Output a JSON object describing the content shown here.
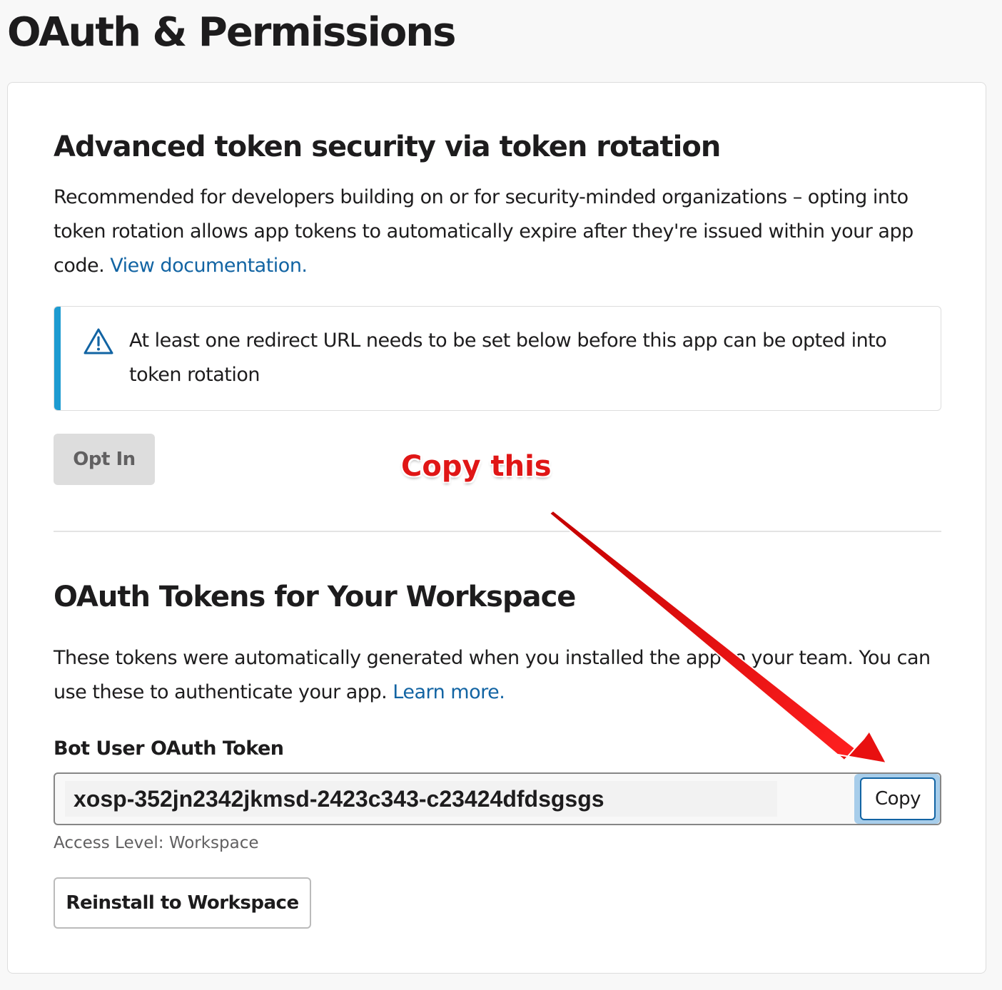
{
  "page": {
    "title": "OAuth & Permissions"
  },
  "token_rotation": {
    "heading": "Advanced token security via token rotation",
    "description": "Recommended for developers building on or for security-minded organizations – opting into token rotation allows app tokens to automatically expire after they're issued within your app code. ",
    "doc_link": "View documentation.",
    "notice": {
      "icon": "warning-triangle-icon",
      "text": "At least one redirect URL needs to be set below before this app can be opted into token rotation",
      "accent_color": "#1d9bd1"
    },
    "opt_in_label": "Opt In"
  },
  "oauth_tokens": {
    "heading": "OAuth Tokens for Your Workspace",
    "description": "These tokens were automatically generated when you installed the app to your team. You can use these to authenticate your app. ",
    "learn_more_link": "Learn more.",
    "bot_token": {
      "label": "Bot User OAuth Token",
      "value": "xosp-352jn2342jkmsd-2423c343-c23424dfdsgsgs",
      "copy_label": "Copy",
      "access_level": "Access Level: Workspace"
    },
    "reinstall_label": "Reinstall to Workspace"
  },
  "annotation": {
    "text": "Copy this",
    "color": "#e01616"
  },
  "colors": {
    "link": "#1264a3",
    "text": "#1d1c1d",
    "muted": "#616061"
  }
}
